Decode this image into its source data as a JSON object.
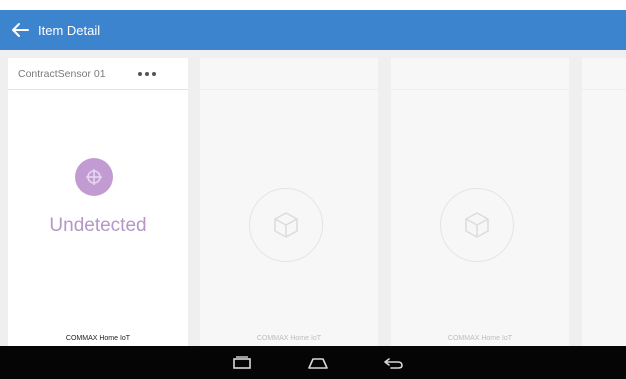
{
  "header": {
    "title": "Item Detail",
    "color": "#3d84cf"
  },
  "cards": [
    {
      "name": "ContractSensor 01",
      "status": "Undetected",
      "footer": "COMMAX Home IoT",
      "icon": "sensor-icon",
      "accent": "#c39bd3"
    },
    {
      "footer": "COMMAX Home IoT",
      "icon": "cube-icon"
    },
    {
      "footer": "COMMAX Home IoT",
      "icon": "cube-icon"
    }
  ],
  "navbar": {
    "icons": [
      "recent-apps-icon",
      "home-icon",
      "back-nav-icon"
    ]
  }
}
